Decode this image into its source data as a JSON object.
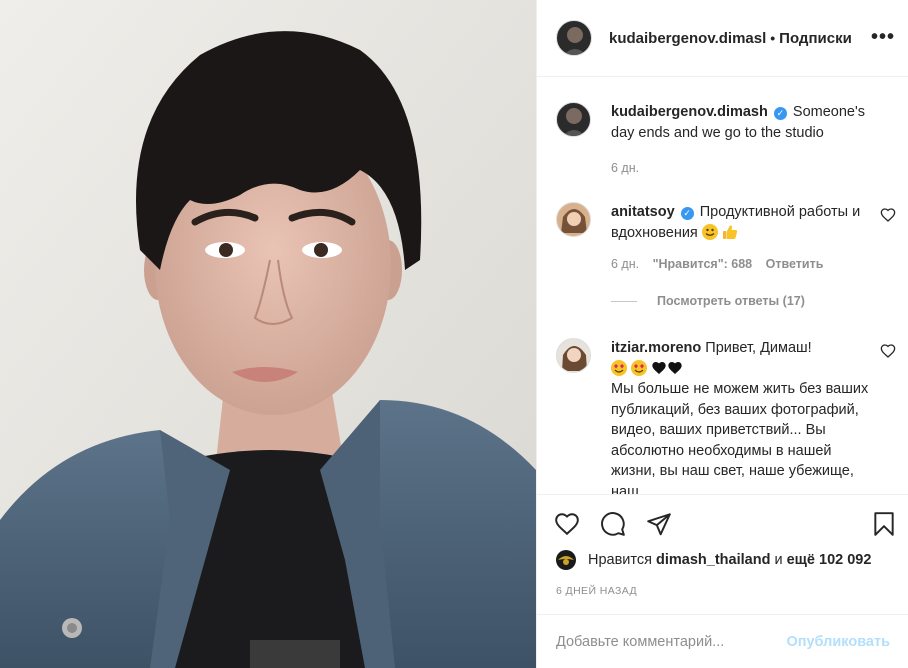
{
  "post": {
    "image_alt": "selfie photo"
  },
  "header": {
    "username": "kudaibergenov.dimasl",
    "separator": "•",
    "follow_status": "Подписки",
    "more": "•••"
  },
  "caption": {
    "username": "kudaibergenov.dimash",
    "verified_mark": "✓",
    "text": "Someone's day ends and we go to the studio",
    "time": "6 дн."
  },
  "comments": [
    {
      "username": "anitatsoy",
      "verified_mark": "✓",
      "text": "Продуктивной работы и вдохновения",
      "emoji": [
        "smile-emoji",
        "thumbs-up-emoji"
      ],
      "time": "6 дн.",
      "likes": "\"Нравится\": 688",
      "reply": "Ответить",
      "view_replies": "Посмотреть ответы (17)"
    },
    {
      "username": "itziar.moreno",
      "text_line1": "Привет, Димаш!",
      "emoji": [
        "heart-eyes-emoji",
        "heart-eyes-emoji",
        "black-heart",
        "black-heart"
      ],
      "text_rest": "Мы больше не можем жить без ваших публикаций, без ваших фотографий, видео, ваших приветствий... Вы абсолютно необходимы в нашей жизни, вы наш свет, наше убежище, наш"
    }
  ],
  "actions": {
    "like_icon": "heart-icon",
    "comment_icon": "comment-icon",
    "share_icon": "paper-plane-icon",
    "save_icon": "bookmark-icon"
  },
  "likes": {
    "prefix": "Нравится",
    "user": "dimash_thailand",
    "middle": "и",
    "count": "ещё 102 092"
  },
  "date": "6 ДНЕЙ НАЗАД",
  "add_comment": {
    "placeholder": "Добавьте комментарий...",
    "post_label": "Опубликовать"
  },
  "colors": {
    "verified": "#3897f0",
    "muted": "#8e8e8e",
    "post_disabled": "#b2dffc"
  }
}
